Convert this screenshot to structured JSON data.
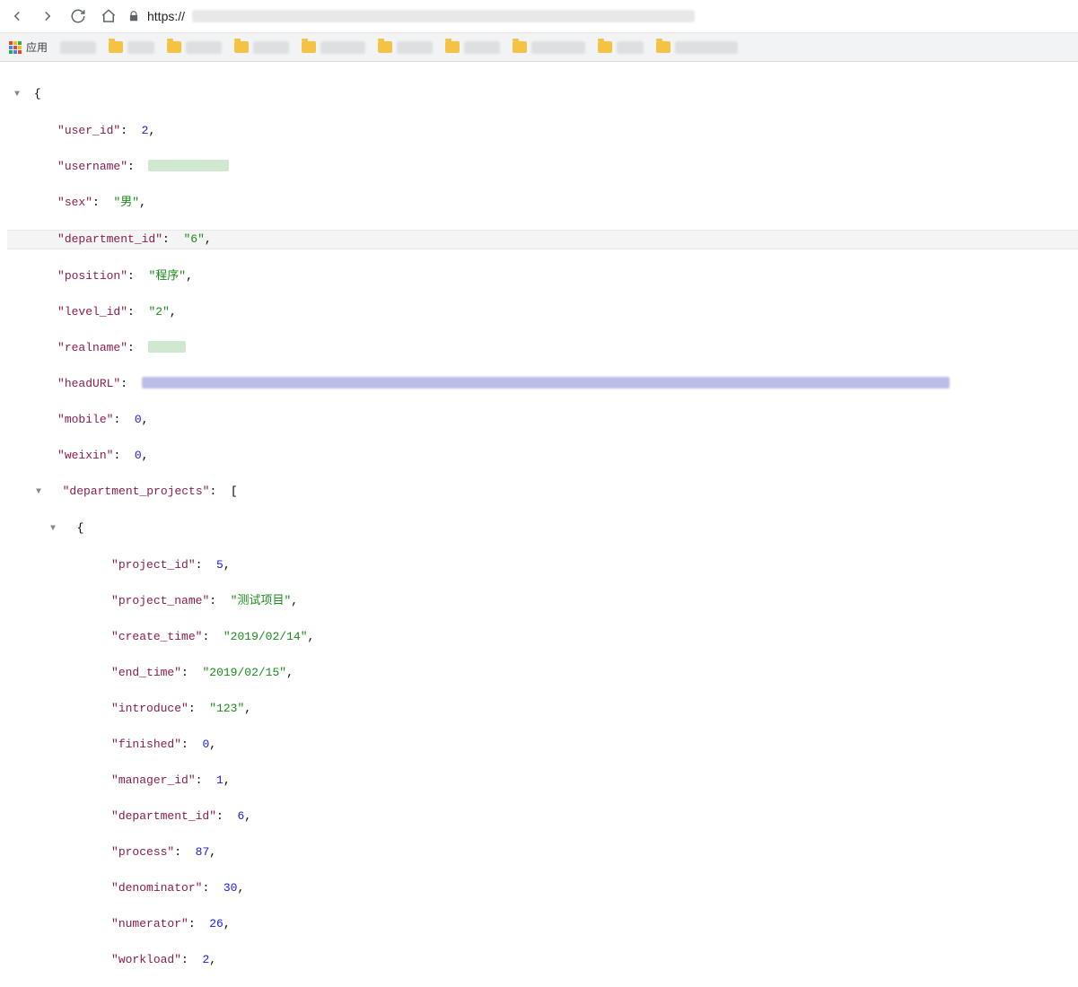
{
  "chrome": {
    "url_prefix": "https://",
    "apps_label": "应用"
  },
  "json": {
    "keys": {
      "user_id": "user_id",
      "username": "username",
      "sex": "sex",
      "department_id": "department_id",
      "position": "position",
      "level_id": "level_id",
      "realname": "realname",
      "headURL": "headURL",
      "mobile": "mobile",
      "weixin": "weixin",
      "department_projects": "department_projects",
      "project_id": "project_id",
      "project_name": "project_name",
      "create_time": "create_time",
      "end_time": "end_time",
      "introduce": "introduce",
      "finished": "finished",
      "manager_id": "manager_id",
      "process": "process",
      "denominator": "denominator",
      "numerator": "numerator",
      "workload": "workload"
    },
    "values": {
      "user_id": "2",
      "sex": "男",
      "department_id": "6",
      "position": "程序",
      "level_id": "2",
      "mobile": "0",
      "weixin": "0",
      "project_id": "5",
      "project_name": "测试项目",
      "create_time": "2019/02/14",
      "end_time": "2019/02/15",
      "introduce": "123",
      "finished": "0",
      "manager_id": "1",
      "project_department_id": "6",
      "process": "87",
      "denominator": "30",
      "numerator": "26",
      "workload": "2"
    }
  }
}
